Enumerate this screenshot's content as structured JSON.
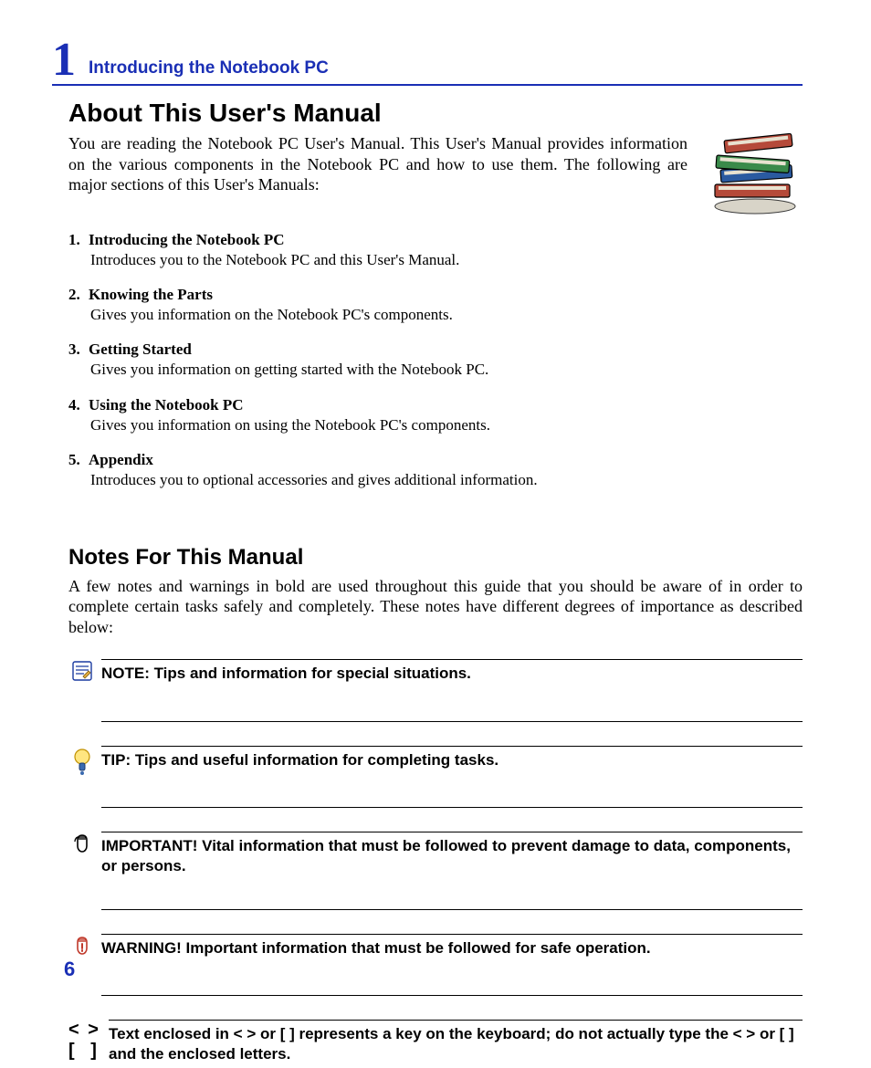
{
  "header": {
    "chapter_number": "1",
    "chapter_title": "Introducing the Notebook PC"
  },
  "about": {
    "heading": "About This User's Manual",
    "intro": "You are reading the Notebook PC User's Manual. This User's Manual provides information on the various components in the Notebook PC and how to use them. The following are major sections of this User's Manuals:",
    "sections": [
      {
        "num": "1.",
        "title": "Introducing the Notebook PC",
        "desc": "Introduces you to the Notebook PC and this User's Manual."
      },
      {
        "num": "2.",
        "title": "Knowing the Parts",
        "desc": "Gives you information on the Notebook PC's components."
      },
      {
        "num": "3.",
        "title": "Getting Started",
        "desc": "Gives you information on getting started with the Notebook PC."
      },
      {
        "num": "4.",
        "title": "Using the Notebook PC",
        "desc": "Gives you information on using the Notebook PC's components."
      },
      {
        "num": "5.",
        "title": "Appendix",
        "desc": "Introduces you to optional accessories and gives additional information."
      }
    ]
  },
  "notes": {
    "heading": "Notes For This Manual",
    "intro": "A few notes and warnings in bold are used throughout this guide that you should be aware of in order to complete certain tasks safely and completely. These notes have different degrees of importance as described below:",
    "items": [
      {
        "icon": "note-icon",
        "text": "NOTE: Tips and information for special situations."
      },
      {
        "icon": "tip-icon",
        "text": "TIP: Tips and useful information for completing tasks."
      },
      {
        "icon": "important-icon",
        "text": "IMPORTANT! Vital information that must be followed to prevent damage to data, components, or persons."
      },
      {
        "icon": "warning-icon",
        "text": "WARNING! Important information that must be followed for safe operation."
      }
    ],
    "key": {
      "sym1": "< >",
      "sym2": "[  ]",
      "text": "Text enclosed in < > or [ ] represents a key on the keyboard; do not actually type the < > or [ ] and the enclosed letters."
    }
  },
  "page_number": "6"
}
